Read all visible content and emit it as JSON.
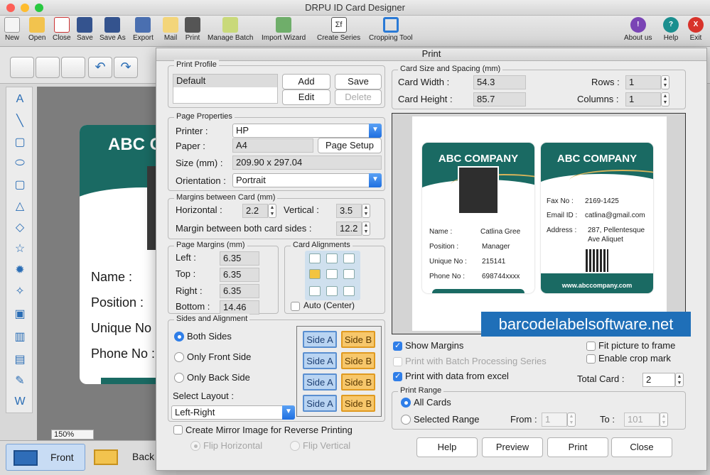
{
  "app": {
    "title": "DRPU ID Card Designer"
  },
  "toolbar": {
    "items": [
      "New",
      "Open",
      "Close",
      "Save",
      "Save As",
      "Export",
      "Mail",
      "Print",
      "Manage Batch",
      "Import Wizard",
      "Create Series",
      "Cropping Tool"
    ],
    "right": [
      "About us",
      "Help",
      "Exit"
    ]
  },
  "canvas": {
    "zoom": "150%",
    "company": "ABC C",
    "fields": [
      "Name :",
      "Position :",
      "Unique No",
      "Phone No :"
    ]
  },
  "tabs": {
    "front": "Front",
    "back": "Back"
  },
  "dialog": {
    "title": "Print",
    "profile": {
      "group": "Print Profile",
      "selected": "Default",
      "add": "Add",
      "save": "Save",
      "edit": "Edit",
      "delete": "Delete"
    },
    "page": {
      "group": "Page Properties",
      "printer_label": "Printer :",
      "printer": "HP",
      "paper_label": "Paper :",
      "paper": "A4",
      "page_setup": "Page Setup",
      "size_label": "Size (mm) :",
      "size": "209.90 x 297.04",
      "orientation_label": "Orientation :",
      "orientation": "Portrait"
    },
    "margins_card": {
      "group": "Margins between Card (mm)",
      "horizontal_label": "Horizontal :",
      "horizontal": "2.2",
      "vertical_label": "Vertical :",
      "vertical": "3.5",
      "both_label": "Margin between both card sides :",
      "both": "12.2"
    },
    "page_margins": {
      "group": "Page Margins (mm)",
      "left_label": "Left :",
      "left": "6.35",
      "top_label": "Top :",
      "top": "6.35",
      "right_label": "Right :",
      "right": "6.35",
      "bottom_label": "Bottom :",
      "bottom": "14.46"
    },
    "alignments": {
      "group": "Card Alignments",
      "auto": "Auto (Center)"
    },
    "sides": {
      "group": "Sides and Alignment",
      "both": "Both Sides",
      "front": "Only Front Side",
      "back": "Only Back Side",
      "layout_label": "Select Layout :",
      "layout": "Left-Right",
      "side_a": "Side A",
      "side_b": "Side B"
    },
    "mirror": {
      "label": "Create Mirror Image for Reverse Printing",
      "flip_h": "Flip Horizontal",
      "flip_v": "Flip Vertical"
    },
    "card_size": {
      "group": "Card Size and Spacing (mm)",
      "width_label": "Card Width :",
      "width": "54.3",
      "height_label": "Card Height :",
      "height": "85.7",
      "rows_label": "Rows :",
      "rows": "1",
      "cols_label": "Columns :",
      "cols": "1"
    },
    "preview": {
      "front": {
        "company": "ABC COMPANY",
        "name_label": "Name :",
        "name": "Catlina Gree",
        "position_label": "Position :",
        "position": "Manager",
        "unique_label": "Unique No :",
        "unique": "215141",
        "phone_label": "Phone No :",
        "phone": "698744xxxx"
      },
      "back": {
        "company": "ABC COMPANY",
        "fax_label": "Fax No :",
        "fax": "2169-1425",
        "email_label": "Email ID :",
        "email": "catlina@gmail.com",
        "address_label": "Address :",
        "address1": "287, Pellentesque",
        "address2": "Ave Aliquet",
        "web": "www.abccompany.com"
      }
    },
    "watermark": "barcodelabelsoftware.net",
    "options": {
      "show_margins": "Show Margins",
      "batch": "Print with Batch Processing Series",
      "excel": "Print with data from excel",
      "fit": "Fit picture to frame",
      "crop": "Enable crop mark",
      "total_label": "Total Card :",
      "total": "2"
    },
    "range": {
      "group": "Print Range",
      "all": "All Cards",
      "selected": "Selected Range",
      "from_label": "From :",
      "from": "1",
      "to_label": "To :",
      "to": "101"
    },
    "buttons": {
      "help": "Help",
      "preview": "Preview",
      "print": "Print",
      "close": "Close"
    }
  }
}
